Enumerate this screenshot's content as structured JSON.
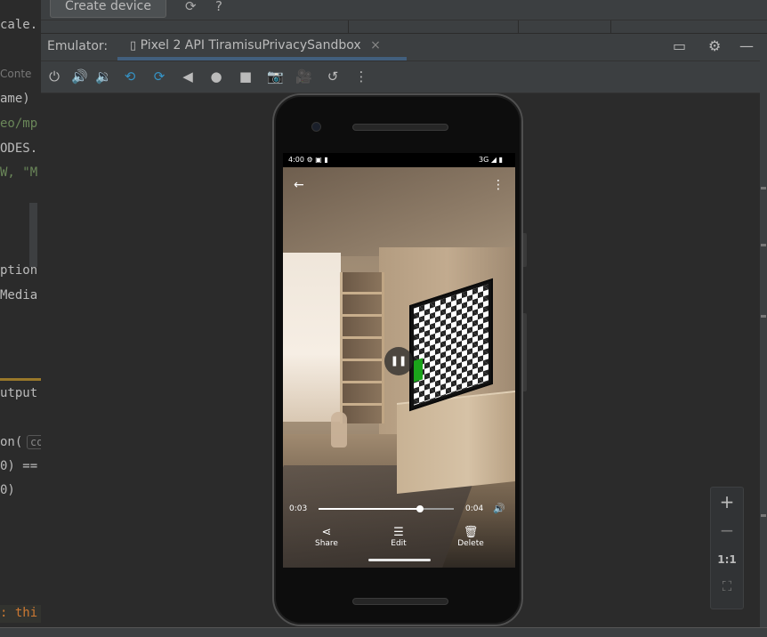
{
  "toolbar": {
    "create_device_label": "Create device",
    "sync_icon": "sync-icon",
    "help_icon": "help-icon"
  },
  "code_snippets": [
    {
      "text": "cale.",
      "cls": ""
    },
    {
      "text": "Conte",
      "cls": "hint"
    },
    {
      "text": "ame)",
      "cls": ""
    },
    {
      "text": "eo/mp",
      "cls": "str"
    },
    {
      "text": "ODES.",
      "cls": ""
    },
    {
      "text": "W, \"M",
      "cls": "str"
    },
    {
      "text": "ption",
      "cls": ""
    },
    {
      "text": "Media",
      "cls": ""
    },
    {
      "text": "utput",
      "cls": ""
    },
    {
      "text": "on(",
      "cls": ""
    },
    {
      "text": "co",
      "cls": "box"
    },
    {
      "text": "0) ==",
      "cls": ""
    },
    {
      "text": "0)",
      "cls": ""
    },
    {
      "text": ": thi",
      "cls": "kw"
    }
  ],
  "emulator": {
    "label": "Emulator:",
    "tab_title": "Pixel 2 API TiramisuPrivacySandbox",
    "tab_close": "×"
  },
  "device": {
    "status_time": "4:00",
    "status_network": "3G",
    "player": {
      "current_time": "0:03",
      "total_time": "0:04",
      "progress_fraction": 0.75,
      "actions": [
        {
          "label": "Share",
          "icon": "share-icon",
          "glyph": "⋖"
        },
        {
          "label": "Edit",
          "icon": "tune-icon",
          "glyph": "☰"
        },
        {
          "label": "Delete",
          "icon": "trash-icon",
          "glyph": "🗑"
        }
      ]
    }
  },
  "zoom": {
    "zoom_in": "+",
    "zoom_out": "−",
    "actual_size": "1:1"
  },
  "colors": {
    "ide_background": "#2b2b2b",
    "panel": "#3c3f41",
    "accent_blue": "#3592c4"
  }
}
